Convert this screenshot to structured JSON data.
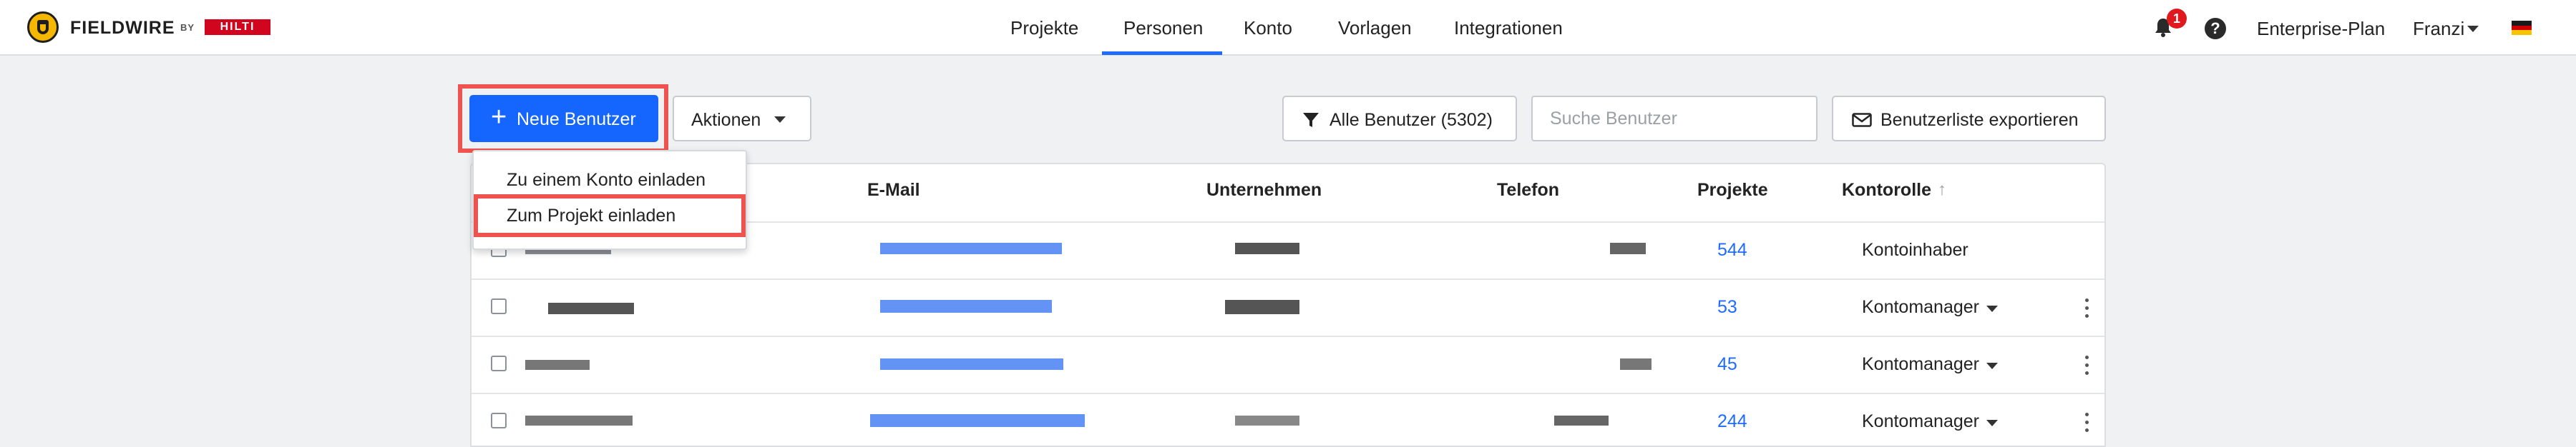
{
  "brand": {
    "name": "FIELDWIRE",
    "by": "BY",
    "partner": "HILTI"
  },
  "nav": {
    "tabs": [
      "Projekte",
      "Personen",
      "Konto",
      "Vorlagen",
      "Integrationen"
    ],
    "active_tab": "Personen"
  },
  "header_right": {
    "notification_count": "1",
    "help_glyph": "?",
    "plan": "Enterprise-Plan",
    "user": "Franzi",
    "language_flag": "german-flag-icon"
  },
  "toolbar": {
    "new_user_label": "Neue Benutzer",
    "actions_label": "Aktionen",
    "filter_label": "Alle Benutzer (5302)",
    "search_placeholder": "Suche Benutzer",
    "export_label": "Benutzerliste exportieren"
  },
  "dropdown": {
    "items": [
      "Zu einem Konto einladen",
      "Zum Projekt einladen"
    ],
    "highlighted_item": "Zum Projekt einladen"
  },
  "table": {
    "columns": [
      "E-Mail",
      "Unternehmen",
      "Telefon",
      "Projekte",
      "Kontorolle"
    ],
    "sort_column": "Kontorolle",
    "sort_direction": "ascending",
    "rows": [
      {
        "projects": "544",
        "role": "Kontoinhaber",
        "role_editable": false
      },
      {
        "projects": "53",
        "role": "Kontomanager",
        "role_editable": true
      },
      {
        "projects": "45",
        "role": "Kontomanager",
        "role_editable": true
      },
      {
        "projects": "244",
        "role": "Kontomanager",
        "role_editable": true
      }
    ]
  },
  "colors": {
    "primary": "#1565ff",
    "link": "#1f6bff",
    "highlight": "#ef5350",
    "badge": "#e0191e",
    "page_bg": "#f0f1f3"
  }
}
